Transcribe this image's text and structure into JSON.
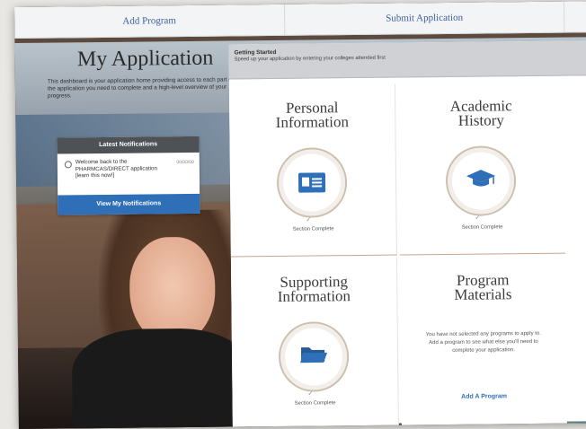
{
  "nav": {
    "items": [
      "Add Program",
      "Submit Application",
      ""
    ]
  },
  "left": {
    "title": "My Application",
    "description": "This dashboard is your application home providing access to each part of the application you need to complete and a high-level overview of your progress."
  },
  "notifications": {
    "header": "Latest Notifications",
    "item_text": "Welcome back to the PHARMCAS/DIRECT application [learn this now!]",
    "item_date": "00/00/00",
    "button_label": "View My Notifications"
  },
  "status": {
    "label": "Getting Started",
    "text": "Speed up your application by entering your colleges attended first"
  },
  "tiles": [
    {
      "title_line1": "Personal",
      "title_line2": "Information",
      "status": "Section Complete",
      "icon": "id-card-icon"
    },
    {
      "title_line1": "Academic",
      "title_line2": "History",
      "status": "Section Complete",
      "icon": "graduation-cap-icon"
    },
    {
      "title_line1": "Supporting",
      "title_line2": "Information",
      "status": "Section Complete",
      "icon": "folder-icon"
    },
    {
      "title_line1": "Program",
      "title_line2": "Materials",
      "text": "You have not selected any programs to apply to. Add a program to see what else you'll need to complete your application.",
      "link": "Add A Program"
    }
  ],
  "colors": {
    "accent": "#2f6fb8",
    "nav_text": "#3f5f99",
    "tile_border": "#c9a58a"
  }
}
